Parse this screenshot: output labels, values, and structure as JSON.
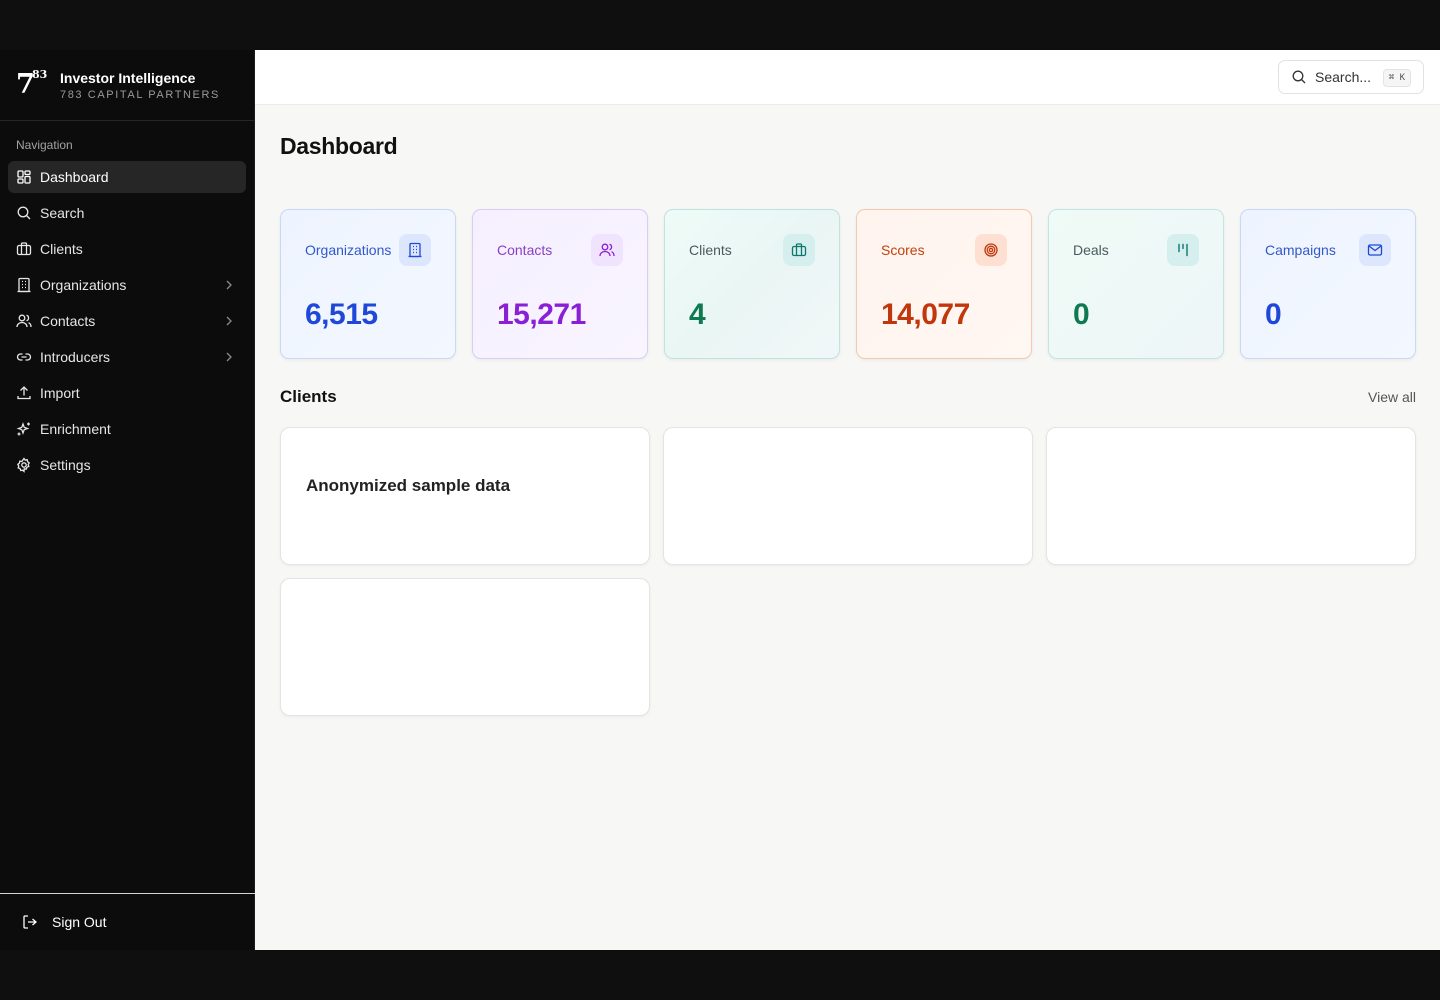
{
  "brand": {
    "logo_big": "7",
    "logo_small": "83",
    "title": "Investor Intelligence",
    "subtitle": "783 CAPITAL PARTNERS"
  },
  "sidebar": {
    "heading": "Navigation",
    "items": [
      {
        "label": "Dashboard",
        "icon": "dashboard-icon",
        "active": true
      },
      {
        "label": "Search",
        "icon": "search-icon"
      },
      {
        "label": "Clients",
        "icon": "briefcase-icon"
      },
      {
        "label": "Organizations",
        "icon": "building-icon",
        "expandable": true
      },
      {
        "label": "Contacts",
        "icon": "users-icon",
        "expandable": true
      },
      {
        "label": "Introducers",
        "icon": "link-icon",
        "expandable": true
      },
      {
        "label": "Import",
        "icon": "upload-icon"
      },
      {
        "label": "Enrichment",
        "icon": "sparkles-icon"
      },
      {
        "label": "Settings",
        "icon": "gear-icon"
      }
    ],
    "sign_out": "Sign Out"
  },
  "topbar": {
    "search_label": "Search...",
    "shortcut": "⌘ K"
  },
  "page": {
    "title": "Dashboard"
  },
  "stats": [
    {
      "label": "Organizations",
      "value": "6,515",
      "icon": "building-icon"
    },
    {
      "label": "Contacts",
      "value": "15,271",
      "icon": "users-icon"
    },
    {
      "label": "Clients",
      "value": "4",
      "icon": "briefcase-icon"
    },
    {
      "label": "Scores",
      "value": "14,077",
      "icon": "target-icon"
    },
    {
      "label": "Deals",
      "value": "0",
      "icon": "pipeline-icon"
    },
    {
      "label": "Campaigns",
      "value": "0",
      "icon": "mail-icon"
    }
  ],
  "clients_section": {
    "title": "Clients",
    "view_all": "View all",
    "cards": [
      {
        "name": "Anonymized sample data"
      },
      {
        "name": ""
      },
      {
        "name": ""
      },
      {
        "name": ""
      }
    ]
  },
  "colors": {
    "sidebar_bg": "#0c0c0c",
    "main_bg": "#f7f7f5",
    "org_blue": "#1f48d8",
    "contacts_purple": "#8a1fd6",
    "clients_green": "#0f7a52",
    "scores_orange": "#c2360c"
  }
}
